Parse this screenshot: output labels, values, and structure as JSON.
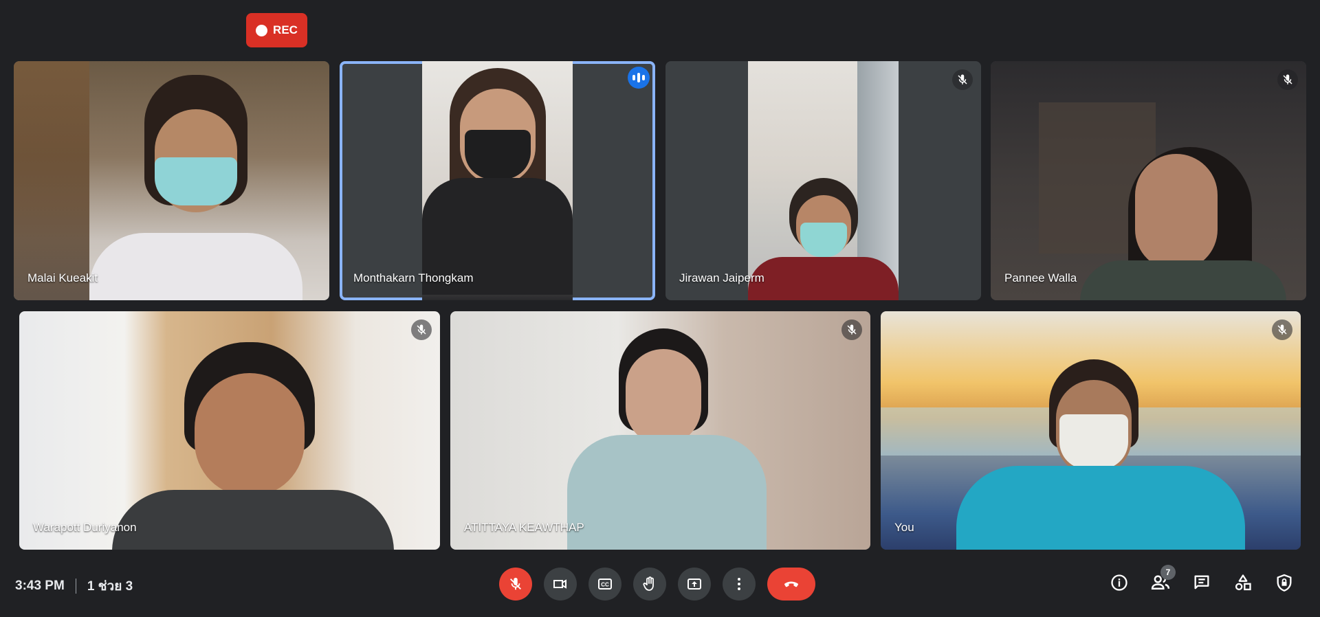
{
  "recording": {
    "label": "REC"
  },
  "participants": [
    {
      "name": "Malai Kueakit",
      "muted": false
    },
    {
      "name": "Monthakarn Thongkam",
      "speaking": true
    },
    {
      "name": "Jirawan Jaiperm",
      "muted": true
    },
    {
      "name": "Pannee Walla",
      "muted": true
    },
    {
      "name": "Warapott Duriyanon",
      "muted": true
    },
    {
      "name": "ATITTAYA KEAWTHAP",
      "muted": true
    },
    {
      "name": "You",
      "muted": true
    }
  ],
  "footer": {
    "time": "3:43 PM",
    "meeting_name": "1 ช่วย 3",
    "people_count": "7"
  },
  "controls": {
    "mic": "mic-off-icon",
    "camera": "camera-icon",
    "captions": "captions-icon",
    "raise_hand": "raise-hand-icon",
    "present": "present-icon",
    "more": "more-options-icon",
    "leave": "end-call-icon"
  },
  "colors": {
    "background": "#202124",
    "tile": "#3c4043",
    "danger": "#ea4335",
    "active_border": "#8ab4f8",
    "speaking": "#1a73e8"
  }
}
